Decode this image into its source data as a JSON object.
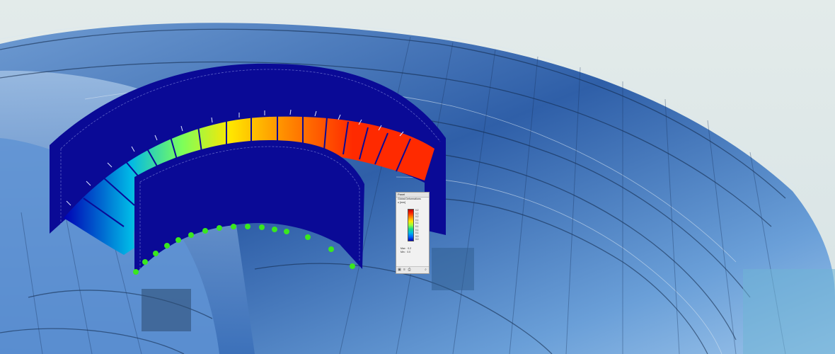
{
  "scene": {
    "colors": {
      "sky": "#dfe9ea",
      "glass": "#3d6fb7",
      "model_blue": "#0a0a96",
      "support_green": "#39e81e"
    }
  },
  "results_panel": {
    "title": "Panel",
    "heading": "Global Deformations",
    "unit": "u [mm]",
    "scale_values": [
      "0.2",
      "0.2",
      "0.2",
      "0.1",
      "0.1",
      "0.1",
      "0.1",
      "0.1",
      "0.0",
      "0.0"
    ],
    "max_label": "Max :",
    "max_value": "0.2",
    "min_label": "Min :",
    "min_value": "0.0",
    "footer_icons": [
      "display-icon",
      "list-icon",
      "print-icon",
      "zoom-icon"
    ]
  }
}
